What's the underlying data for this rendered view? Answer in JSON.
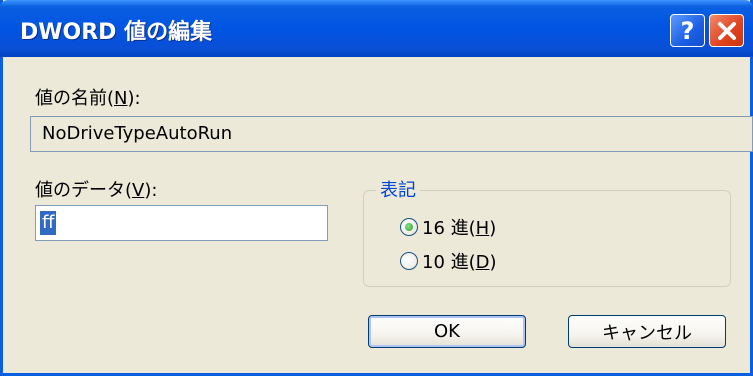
{
  "window": {
    "title": "DWORD 値の編集",
    "help_glyph": "?",
    "close_glyph": "✕"
  },
  "value_name": {
    "label_text": "値の名前(",
    "label_key": "N",
    "label_end": "):",
    "value": "NoDriveTypeAutoRun"
  },
  "value_data": {
    "label_text": "値のデータ(",
    "label_key": "V",
    "label_end": "):",
    "value": "ff"
  },
  "base": {
    "title": "表記",
    "options": [
      {
        "label_text": "16 進(",
        "key": "H",
        "label_end": ")",
        "checked": true
      },
      {
        "label_text": "10 進(",
        "key": "D",
        "label_end": ")",
        "checked": false
      }
    ]
  },
  "buttons": {
    "ok": "OK",
    "cancel": "キャンセル"
  }
}
